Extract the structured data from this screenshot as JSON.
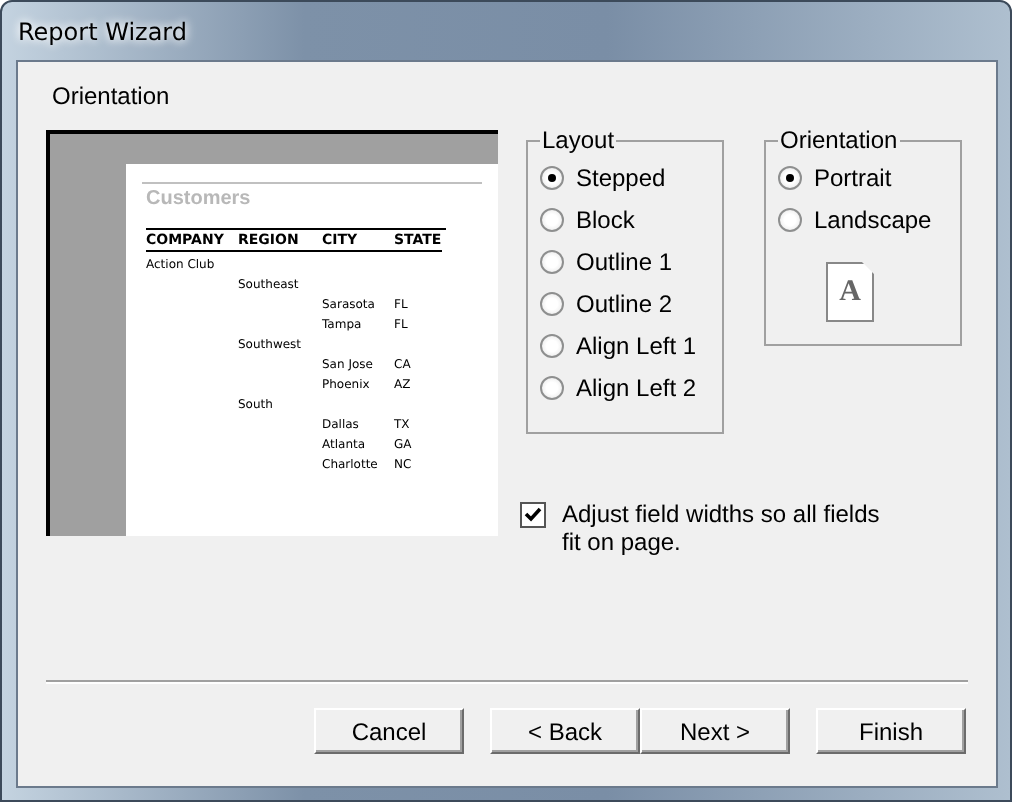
{
  "window": {
    "title": "Report Wizard"
  },
  "heading": "Orientation",
  "preview": {
    "title": "Customers",
    "columns": [
      "COMPANY",
      "REGION",
      "CITY",
      "STATE"
    ],
    "rows": [
      {
        "kind": "company",
        "text": "Action Club"
      },
      {
        "kind": "region",
        "text": "Southeast"
      },
      {
        "kind": "city",
        "city": "Sarasota",
        "state": "FL"
      },
      {
        "kind": "city",
        "city": "Tampa",
        "state": "FL"
      },
      {
        "kind": "region",
        "text": "Southwest"
      },
      {
        "kind": "city",
        "city": "San Jose",
        "state": "CA"
      },
      {
        "kind": "city",
        "city": "Phoenix",
        "state": "AZ"
      },
      {
        "kind": "region",
        "text": "South"
      },
      {
        "kind": "city",
        "city": "Dallas",
        "state": "TX"
      },
      {
        "kind": "city",
        "city": "Atlanta",
        "state": "GA"
      },
      {
        "kind": "city",
        "city": "Charlotte",
        "state": "NC"
      }
    ]
  },
  "layout": {
    "label": "Layout",
    "options": [
      {
        "label": "Stepped",
        "selected": true
      },
      {
        "label": "Block",
        "selected": false
      },
      {
        "label": "Outline 1",
        "selected": false
      },
      {
        "label": "Outline 2",
        "selected": false
      },
      {
        "label": "Align Left 1",
        "selected": false
      },
      {
        "label": "Align Left 2",
        "selected": false
      }
    ]
  },
  "orientation": {
    "label": "Orientation",
    "options": [
      {
        "label": "Portrait",
        "selected": true
      },
      {
        "label": "Landscape",
        "selected": false
      }
    ],
    "page_letter": "A"
  },
  "adjust": {
    "label": "Adjust field widths so all fields fit on page.",
    "checked": true
  },
  "buttons": [
    "Cancel",
    "< Back",
    "Next >",
    "Finish"
  ]
}
